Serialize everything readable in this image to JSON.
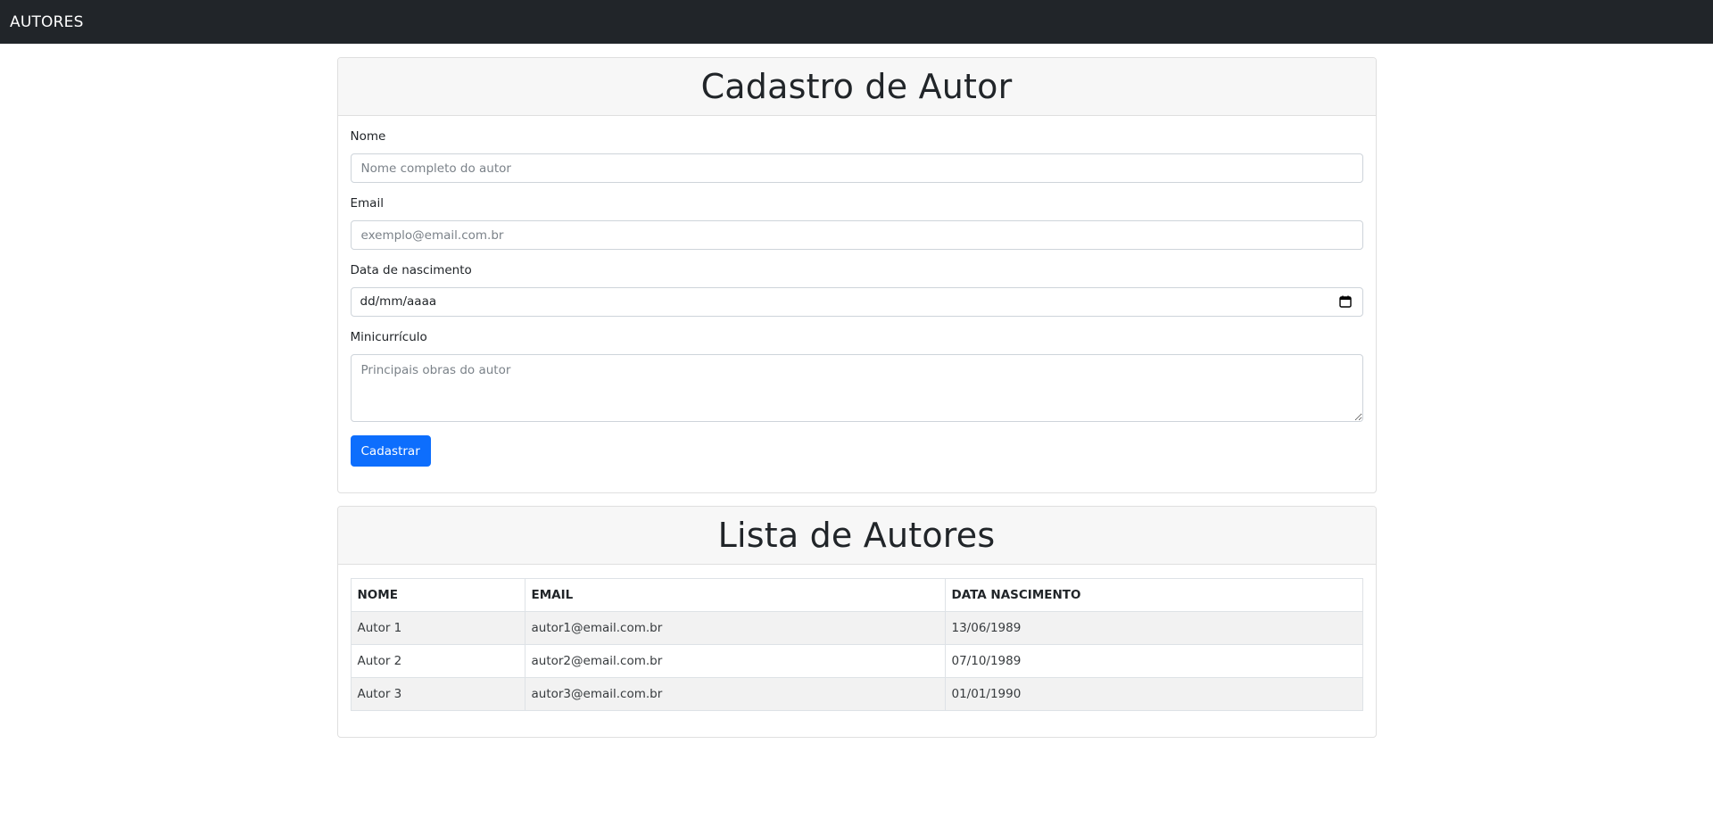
{
  "navbar": {
    "brand": "AUTORES"
  },
  "form_card": {
    "title": "Cadastro de Autor",
    "fields": {
      "nome": {
        "label": "Nome",
        "placeholder": "Nome completo do autor",
        "value": ""
      },
      "email": {
        "label": "Email",
        "placeholder": "exemplo@email.com.br",
        "value": ""
      },
      "nascimento": {
        "label": "Data de nascimento",
        "display": "dd/mm/aaaa",
        "icon": "calendar-icon"
      },
      "minicurriculo": {
        "label": "Minicurrículo",
        "placeholder": "Principais obras do autor",
        "value": ""
      }
    },
    "submit_label": "Cadastrar",
    "accent_color": "#0d6efd"
  },
  "list_card": {
    "title": "Lista de Autores",
    "columns": [
      "NOME",
      "EMAIL",
      "DATA NASCIMENTO"
    ],
    "rows": [
      [
        "Autor 1",
        "autor1@email.com.br",
        "13/06/1989"
      ],
      [
        "Autor 2",
        "autor2@email.com.br",
        "07/10/1989"
      ],
      [
        "Autor 3",
        "autor3@email.com.br",
        "01/01/1990"
      ]
    ]
  }
}
